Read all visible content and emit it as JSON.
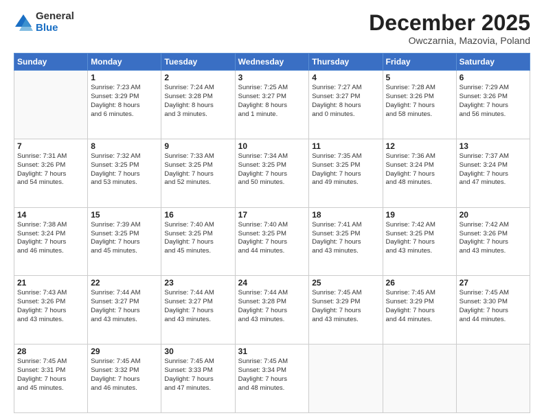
{
  "logo": {
    "general": "General",
    "blue": "Blue"
  },
  "header": {
    "month": "December 2025",
    "location": "Owczarnia, Mazovia, Poland"
  },
  "weekdays": [
    "Sunday",
    "Monday",
    "Tuesday",
    "Wednesday",
    "Thursday",
    "Friday",
    "Saturday"
  ],
  "weeks": [
    [
      {
        "day": "",
        "info": ""
      },
      {
        "day": "1",
        "info": "Sunrise: 7:23 AM\nSunset: 3:29 PM\nDaylight: 8 hours\nand 6 minutes."
      },
      {
        "day": "2",
        "info": "Sunrise: 7:24 AM\nSunset: 3:28 PM\nDaylight: 8 hours\nand 3 minutes."
      },
      {
        "day": "3",
        "info": "Sunrise: 7:25 AM\nSunset: 3:27 PM\nDaylight: 8 hours\nand 1 minute."
      },
      {
        "day": "4",
        "info": "Sunrise: 7:27 AM\nSunset: 3:27 PM\nDaylight: 8 hours\nand 0 minutes."
      },
      {
        "day": "5",
        "info": "Sunrise: 7:28 AM\nSunset: 3:26 PM\nDaylight: 7 hours\nand 58 minutes."
      },
      {
        "day": "6",
        "info": "Sunrise: 7:29 AM\nSunset: 3:26 PM\nDaylight: 7 hours\nand 56 minutes."
      }
    ],
    [
      {
        "day": "7",
        "info": "Sunrise: 7:31 AM\nSunset: 3:26 PM\nDaylight: 7 hours\nand 54 minutes."
      },
      {
        "day": "8",
        "info": "Sunrise: 7:32 AM\nSunset: 3:25 PM\nDaylight: 7 hours\nand 53 minutes."
      },
      {
        "day": "9",
        "info": "Sunrise: 7:33 AM\nSunset: 3:25 PM\nDaylight: 7 hours\nand 52 minutes."
      },
      {
        "day": "10",
        "info": "Sunrise: 7:34 AM\nSunset: 3:25 PM\nDaylight: 7 hours\nand 50 minutes."
      },
      {
        "day": "11",
        "info": "Sunrise: 7:35 AM\nSunset: 3:25 PM\nDaylight: 7 hours\nand 49 minutes."
      },
      {
        "day": "12",
        "info": "Sunrise: 7:36 AM\nSunset: 3:24 PM\nDaylight: 7 hours\nand 48 minutes."
      },
      {
        "day": "13",
        "info": "Sunrise: 7:37 AM\nSunset: 3:24 PM\nDaylight: 7 hours\nand 47 minutes."
      }
    ],
    [
      {
        "day": "14",
        "info": "Sunrise: 7:38 AM\nSunset: 3:24 PM\nDaylight: 7 hours\nand 46 minutes."
      },
      {
        "day": "15",
        "info": "Sunrise: 7:39 AM\nSunset: 3:25 PM\nDaylight: 7 hours\nand 45 minutes."
      },
      {
        "day": "16",
        "info": "Sunrise: 7:40 AM\nSunset: 3:25 PM\nDaylight: 7 hours\nand 45 minutes."
      },
      {
        "day": "17",
        "info": "Sunrise: 7:40 AM\nSunset: 3:25 PM\nDaylight: 7 hours\nand 44 minutes."
      },
      {
        "day": "18",
        "info": "Sunrise: 7:41 AM\nSunset: 3:25 PM\nDaylight: 7 hours\nand 43 minutes."
      },
      {
        "day": "19",
        "info": "Sunrise: 7:42 AM\nSunset: 3:25 PM\nDaylight: 7 hours\nand 43 minutes."
      },
      {
        "day": "20",
        "info": "Sunrise: 7:42 AM\nSunset: 3:26 PM\nDaylight: 7 hours\nand 43 minutes."
      }
    ],
    [
      {
        "day": "21",
        "info": "Sunrise: 7:43 AM\nSunset: 3:26 PM\nDaylight: 7 hours\nand 43 minutes."
      },
      {
        "day": "22",
        "info": "Sunrise: 7:44 AM\nSunset: 3:27 PM\nDaylight: 7 hours\nand 43 minutes."
      },
      {
        "day": "23",
        "info": "Sunrise: 7:44 AM\nSunset: 3:27 PM\nDaylight: 7 hours\nand 43 minutes."
      },
      {
        "day": "24",
        "info": "Sunrise: 7:44 AM\nSunset: 3:28 PM\nDaylight: 7 hours\nand 43 minutes."
      },
      {
        "day": "25",
        "info": "Sunrise: 7:45 AM\nSunset: 3:29 PM\nDaylight: 7 hours\nand 43 minutes."
      },
      {
        "day": "26",
        "info": "Sunrise: 7:45 AM\nSunset: 3:29 PM\nDaylight: 7 hours\nand 44 minutes."
      },
      {
        "day": "27",
        "info": "Sunrise: 7:45 AM\nSunset: 3:30 PM\nDaylight: 7 hours\nand 44 minutes."
      }
    ],
    [
      {
        "day": "28",
        "info": "Sunrise: 7:45 AM\nSunset: 3:31 PM\nDaylight: 7 hours\nand 45 minutes."
      },
      {
        "day": "29",
        "info": "Sunrise: 7:45 AM\nSunset: 3:32 PM\nDaylight: 7 hours\nand 46 minutes."
      },
      {
        "day": "30",
        "info": "Sunrise: 7:45 AM\nSunset: 3:33 PM\nDaylight: 7 hours\nand 47 minutes."
      },
      {
        "day": "31",
        "info": "Sunrise: 7:45 AM\nSunset: 3:34 PM\nDaylight: 7 hours\nand 48 minutes."
      },
      {
        "day": "",
        "info": ""
      },
      {
        "day": "",
        "info": ""
      },
      {
        "day": "",
        "info": ""
      }
    ]
  ]
}
